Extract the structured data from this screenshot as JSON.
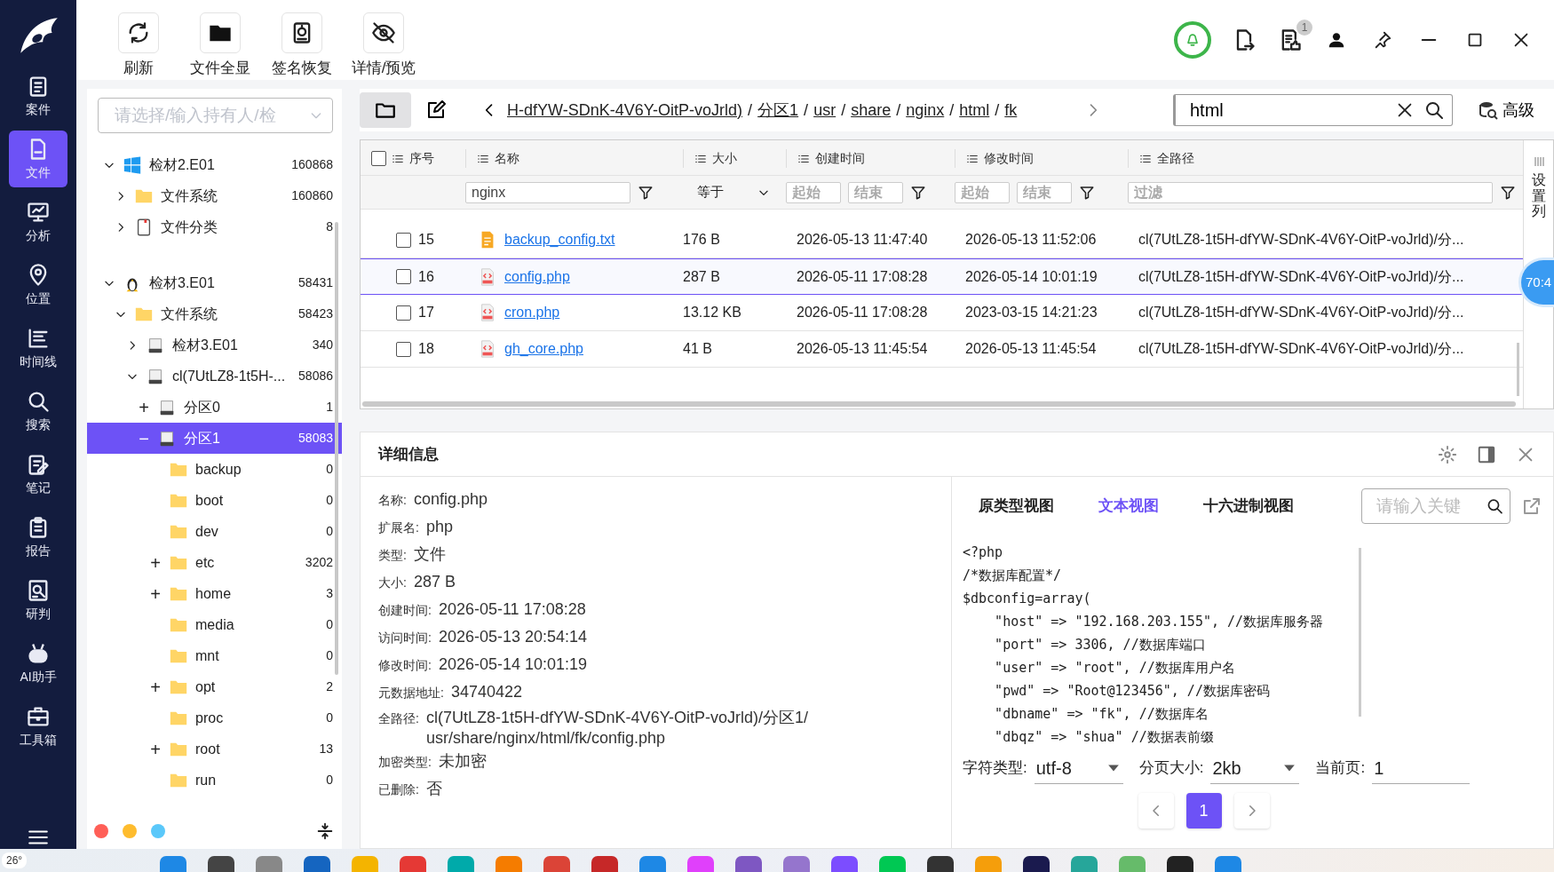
{
  "toolbar": [
    {
      "label": "刷新",
      "kind": "refresh"
    },
    {
      "label": "文件全显",
      "kind": "folder"
    },
    {
      "label": "签名恢复",
      "kind": "restore"
    },
    {
      "label": "详情/预览",
      "kind": "eye-off"
    }
  ],
  "header": {
    "notification_count": "1"
  },
  "sidebar": {
    "items": [
      {
        "label": "案件",
        "kind": "case",
        "selected": false
      },
      {
        "label": "文件",
        "kind": "file",
        "selected": true
      },
      {
        "label": "分析",
        "kind": "analysis",
        "selected": false
      },
      {
        "label": "位置",
        "kind": "location",
        "selected": false
      },
      {
        "label": "时间线",
        "kind": "timeline",
        "selected": false
      },
      {
        "label": "搜索",
        "kind": "search",
        "selected": false
      },
      {
        "label": "笔记",
        "kind": "note",
        "selected": false
      },
      {
        "label": "报告",
        "kind": "report",
        "selected": false
      },
      {
        "label": "研判",
        "kind": "judge",
        "selected": false
      },
      {
        "label": "AI助手",
        "kind": "robot",
        "selected": false
      },
      {
        "label": "工具箱",
        "kind": "toolbox",
        "selected": false
      }
    ]
  },
  "tree": {
    "placeholder": "请选择/输入持有人/检",
    "nodes": [
      {
        "label": "检材2.E01",
        "count": "160868",
        "kind": "windows",
        "expanded": true,
        "selected": false,
        "children": [
          {
            "label": "文件系统",
            "count": "160860",
            "kind": "folder",
            "expanded": false,
            "selected": false
          },
          {
            "label": "文件分类",
            "count": "8",
            "kind": "doc",
            "expanded": false,
            "selected": false
          }
        ]
      },
      {
        "label": "检材3.E01",
        "count": "58431",
        "kind": "linux",
        "expanded": true,
        "selected": false,
        "children": [
          {
            "label": "文件系统",
            "count": "58423",
            "kind": "folder",
            "expanded": true,
            "selected": false,
            "children": [
              {
                "label": "检材3.E01",
                "count": "340",
                "kind": "disk",
                "expanded": false,
                "selected": false
              },
              {
                "label": "cl(7UtLZ8-1t5H-...",
                "count": "58086",
                "kind": "disk",
                "expanded": true,
                "selected": false,
                "children": [
                  {
                    "label": "分区0",
                    "count": "1",
                    "kind": "disk",
                    "toggle": "+",
                    "selected": false
                  },
                  {
                    "label": "分区1",
                    "count": "58083",
                    "kind": "disk",
                    "toggle": "−",
                    "selected": true,
                    "children": [
                      {
                        "label": "backup",
                        "count": "0",
                        "kind": "folder",
                        "selected": false
                      },
                      {
                        "label": "boot",
                        "count": "0",
                        "kind": "folder",
                        "selected": false
                      },
                      {
                        "label": "dev",
                        "count": "0",
                        "kind": "folder",
                        "selected": false
                      },
                      {
                        "label": "etc",
                        "count": "3202",
                        "kind": "folder",
                        "toggle": "+",
                        "selected": false
                      },
                      {
                        "label": "home",
                        "count": "3",
                        "kind": "folder",
                        "toggle": "+",
                        "selected": false
                      },
                      {
                        "label": "media",
                        "count": "0",
                        "kind": "folder",
                        "selected": false
                      },
                      {
                        "label": "mnt",
                        "count": "0",
                        "kind": "folder",
                        "selected": false
                      },
                      {
                        "label": "opt",
                        "count": "2",
                        "kind": "folder",
                        "toggle": "+",
                        "selected": false
                      },
                      {
                        "label": "proc",
                        "count": "0",
                        "kind": "folder",
                        "selected": false
                      },
                      {
                        "label": "root",
                        "count": "13",
                        "kind": "folder",
                        "toggle": "+",
                        "selected": false
                      },
                      {
                        "label": "run",
                        "count": "0",
                        "kind": "folder",
                        "selected": false
                      }
                    ]
                  }
                ]
              }
            ]
          }
        ]
      }
    ],
    "status_dots": [
      {
        "color": "#ff5f57"
      },
      {
        "color": "#febc2e"
      },
      {
        "color": "#5ac8fa"
      }
    ]
  },
  "breadcrumb": {
    "separator": "/",
    "segments": [
      "H-dfYW-SDnK-4V6Y-OitP-voJrld)",
      "分区1",
      "usr",
      "share",
      "nginx",
      "html",
      "fk"
    ]
  },
  "search": {
    "value": "html",
    "advanced_label": "高级"
  },
  "table": {
    "header_checked": false,
    "columns": [
      "序号",
      "名称",
      "大小",
      "创建时间",
      "修改时间",
      "全路径"
    ],
    "filters": {
      "name": {
        "value": "nginx"
      },
      "size_op": "等于",
      "created": [
        {
          "placeholder": "起始"
        },
        {
          "placeholder": "结束"
        }
      ],
      "modified": [
        {
          "placeholder": "起始"
        },
        {
          "placeholder": "结束"
        }
      ],
      "path": {
        "placeholder": "过滤"
      }
    },
    "rows": [
      {
        "index": "15",
        "name": "backup_config.txt",
        "kind": "txt",
        "size": "176 B",
        "created": "2026-05-13 11:47:40",
        "modified": "2026-05-13 11:52:06",
        "path": "cl(7UtLZ8-1t5H-dfYW-SDnK-4V6Y-OitP-voJrld)/分...",
        "checked": false,
        "selected": false
      },
      {
        "index": "16",
        "name": "config.php",
        "kind": "html",
        "size": "287 B",
        "created": "2026-05-11 17:08:28",
        "modified": "2026-05-14 10:01:19",
        "path": "cl(7UtLZ8-1t5H-dfYW-SDnK-4V6Y-OitP-voJrld)/分...",
        "checked": false,
        "selected": true
      },
      {
        "index": "17",
        "name": "cron.php",
        "kind": "html",
        "size": "13.12 KB",
        "created": "2026-05-11 17:08:28",
        "modified": "2023-03-15 14:21:23",
        "path": "cl(7UtLZ8-1t5H-dfYW-SDnK-4V6Y-OitP-voJrld)/分...",
        "checked": false,
        "selected": false
      },
      {
        "index": "18",
        "name": "gh_core.php",
        "kind": "html",
        "size": "41 B",
        "created": "2026-05-13 11:45:54",
        "modified": "2026-05-13 11:45:54",
        "path": "cl(7UtLZ8-1t5H-dfYW-SDnK-4V6Y-OitP-voJrld)/分...",
        "checked": false,
        "selected": false
      }
    ],
    "settings_label": "设置列"
  },
  "timer": "70:4",
  "details": {
    "title": "详细信息",
    "fields": [
      {
        "label": "名称:",
        "value": "config.php"
      },
      {
        "label": "扩展名:",
        "value": "php"
      },
      {
        "label": "类型:",
        "value": "文件"
      },
      {
        "label": "大小:",
        "value": "287 B"
      },
      {
        "label": "创建时间:",
        "value": "2026-05-11 17:08:28"
      },
      {
        "label": "访问时间:",
        "value": "2026-05-13 20:54:14"
      },
      {
        "label": "修改时间:",
        "value": "2026-05-14 10:01:19"
      },
      {
        "label": "元数据地址:",
        "value": "34740422"
      },
      {
        "label": "全路径:",
        "value": "cl(7UtLZ8-1t5H-dfYW-SDnK-4V6Y-OitP-voJrld)/分区1/usr/share/nginx/html/fk/config.php"
      },
      {
        "label": "加密类型:",
        "value": "未加密"
      },
      {
        "label": "已删除:",
        "value": "否"
      }
    ]
  },
  "viewer": {
    "tabs": [
      {
        "label": "原类型视图",
        "selected": false
      },
      {
        "label": "文本视图",
        "selected": true
      },
      {
        "label": "十六进制视图",
        "selected": false
      }
    ],
    "search_placeholder": "请输入关键",
    "code_lines": [
      "<?php",
      "/*数据库配置*/",
      "$dbconfig=array(",
      "    \"host\" => \"192.168.203.155\", //数据库服务器",
      "    \"port\" => 3306, //数据库端口",
      "    \"user\" => \"root\", //数据库用户名",
      "    \"pwd\" => \"Root@123456\", //数据库密码",
      "    \"dbname\" => \"fk\", //数据库名",
      "    \"dbqz\" => \"shua\" //数据表前缀"
    ],
    "charset": {
      "label": "字符类型:",
      "value": "utf-8"
    },
    "page_size": {
      "label": "分页大小:",
      "value": "2kb"
    },
    "current_page": {
      "label": "当前页:",
      "value": "1"
    },
    "pages": [
      {
        "label": "1",
        "selected": true
      }
    ]
  },
  "taskbar": {
    "weather": "26°"
  }
}
